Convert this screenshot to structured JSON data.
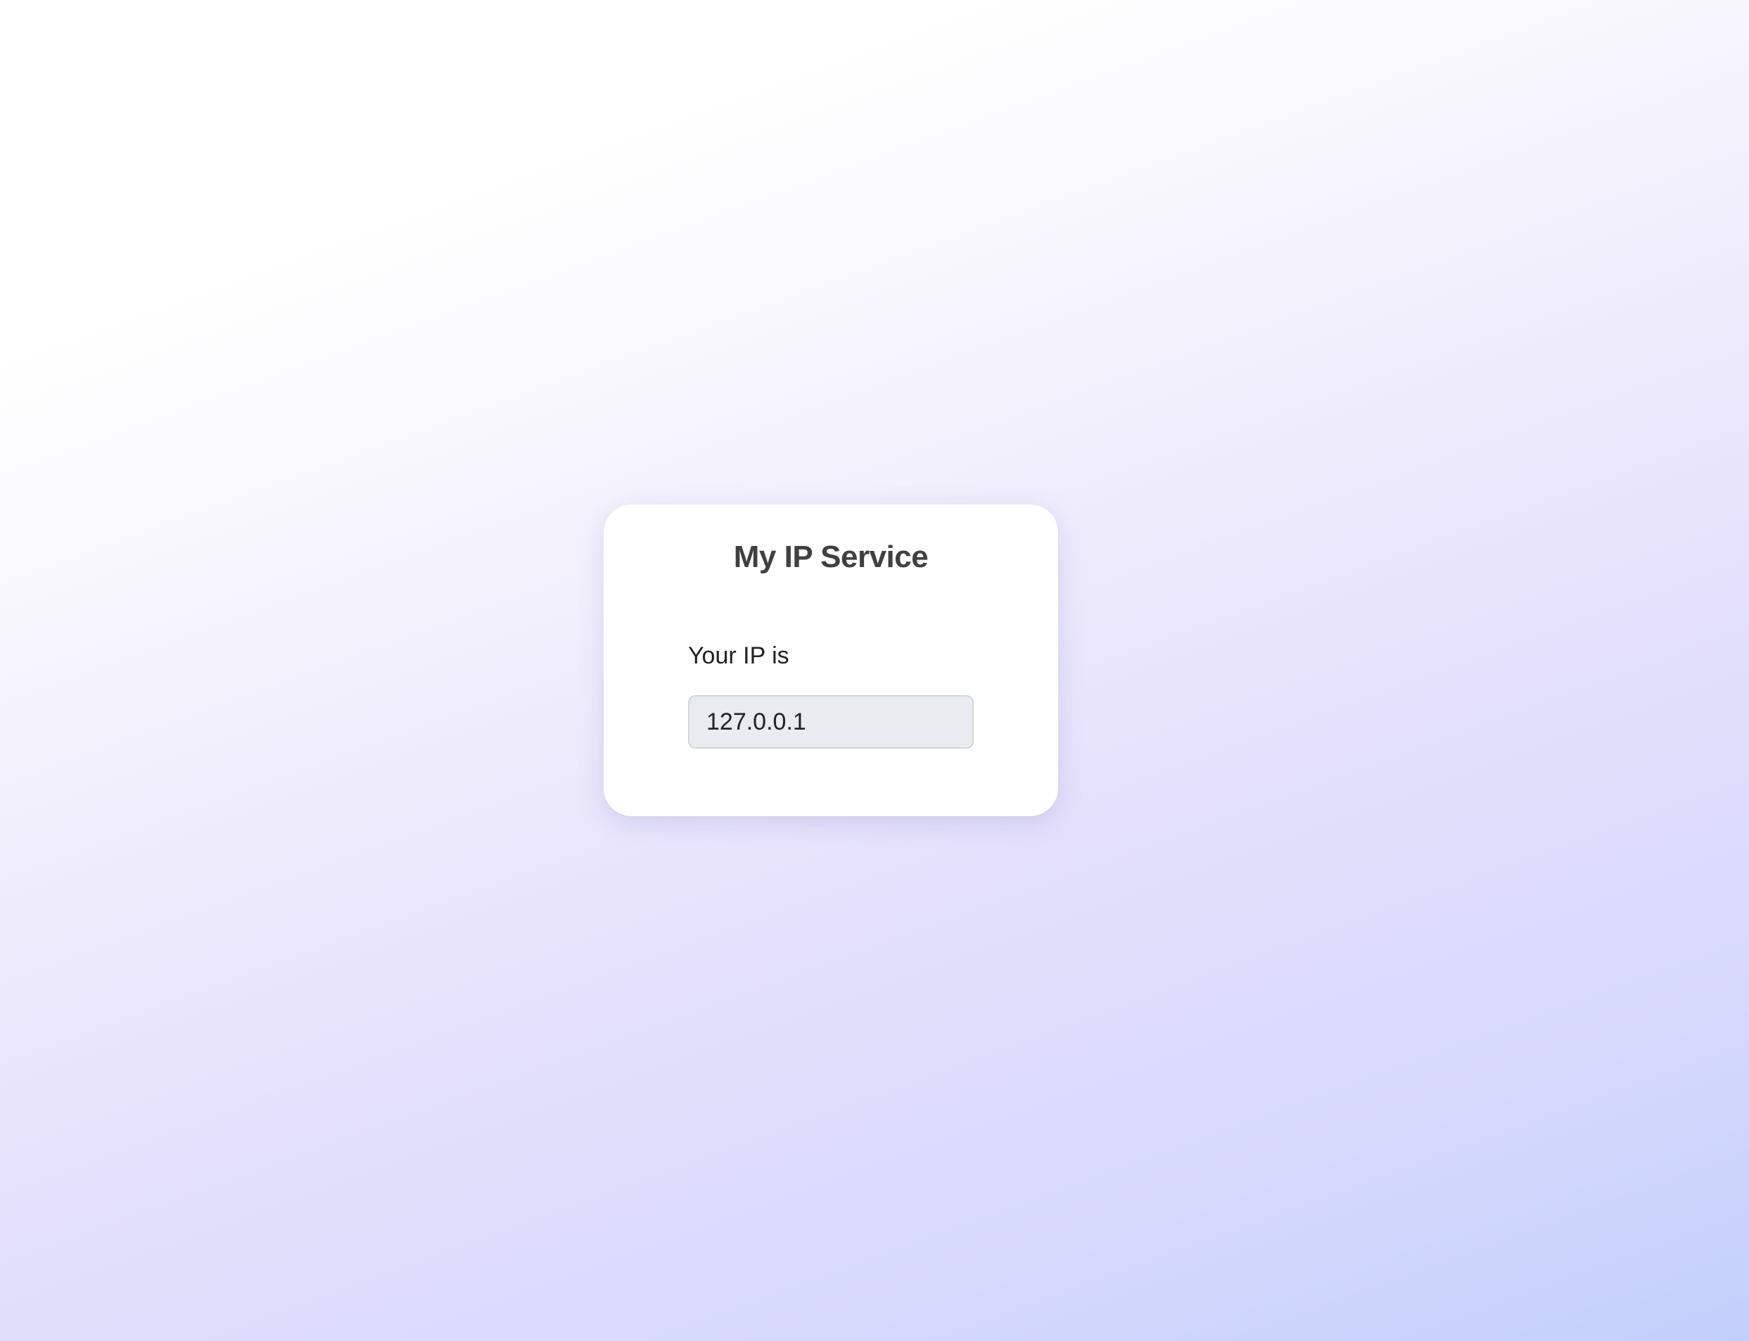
{
  "page": {
    "title": "My IP Service",
    "ip_label": "Your IP is",
    "ip_value": "127.0.0.1"
  },
  "colors": {
    "title_text": "#404040",
    "body_text": "#222222",
    "field_background": "#e8ebef",
    "gradient_end": "#c2cffb"
  }
}
